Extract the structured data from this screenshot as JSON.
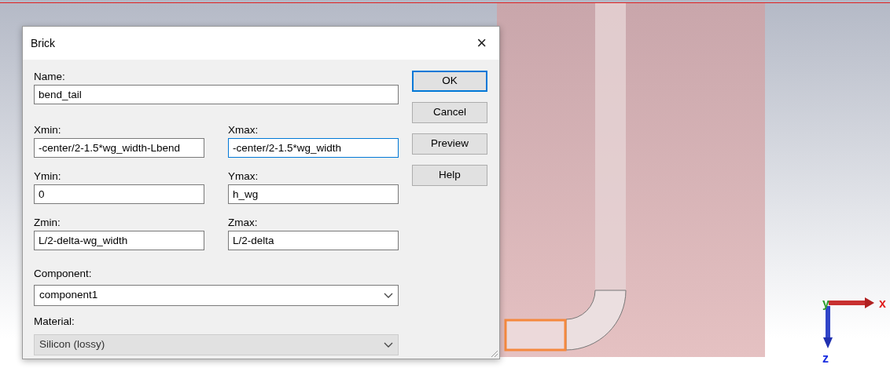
{
  "dialog": {
    "title": "Brick",
    "close": "×",
    "name_field": {
      "label": "Name:",
      "value": "bend_tail",
      "focused": false
    },
    "coordinate_fields": [
      {
        "label": "Xmin:",
        "value": "-center/2-1.5*wg_width-Lbend",
        "focused": false
      },
      {
        "label": "Xmax:",
        "value": "-center/2-1.5*wg_width",
        "focused": true
      },
      {
        "label": "Ymin:",
        "value": "0",
        "focused": false
      },
      {
        "label": "Ymax:",
        "value": "h_wg",
        "focused": false
      },
      {
        "label": "Zmin:",
        "value": "L/2-delta-wg_width",
        "focused": false
      },
      {
        "label": "Zmax:",
        "value": "L/2-delta",
        "focused": false
      }
    ],
    "selects": [
      {
        "label": "Component:",
        "value": "component1",
        "disabled": false
      },
      {
        "label": "Material:",
        "value": "Silicon (lossy)",
        "disabled": true
      }
    ],
    "buttons": [
      {
        "label": "OK",
        "default": true
      },
      {
        "label": "Cancel",
        "default": false
      },
      {
        "label": "Preview",
        "default": false
      },
      {
        "label": "Help",
        "default": false
      }
    ]
  },
  "viewport": {
    "axes": [
      {
        "label": "y",
        "color": "#2e9e2e"
      },
      {
        "label": "x",
        "color": "#e02020"
      },
      {
        "label": "z",
        "color": "#1a2ee0"
      }
    ]
  }
}
